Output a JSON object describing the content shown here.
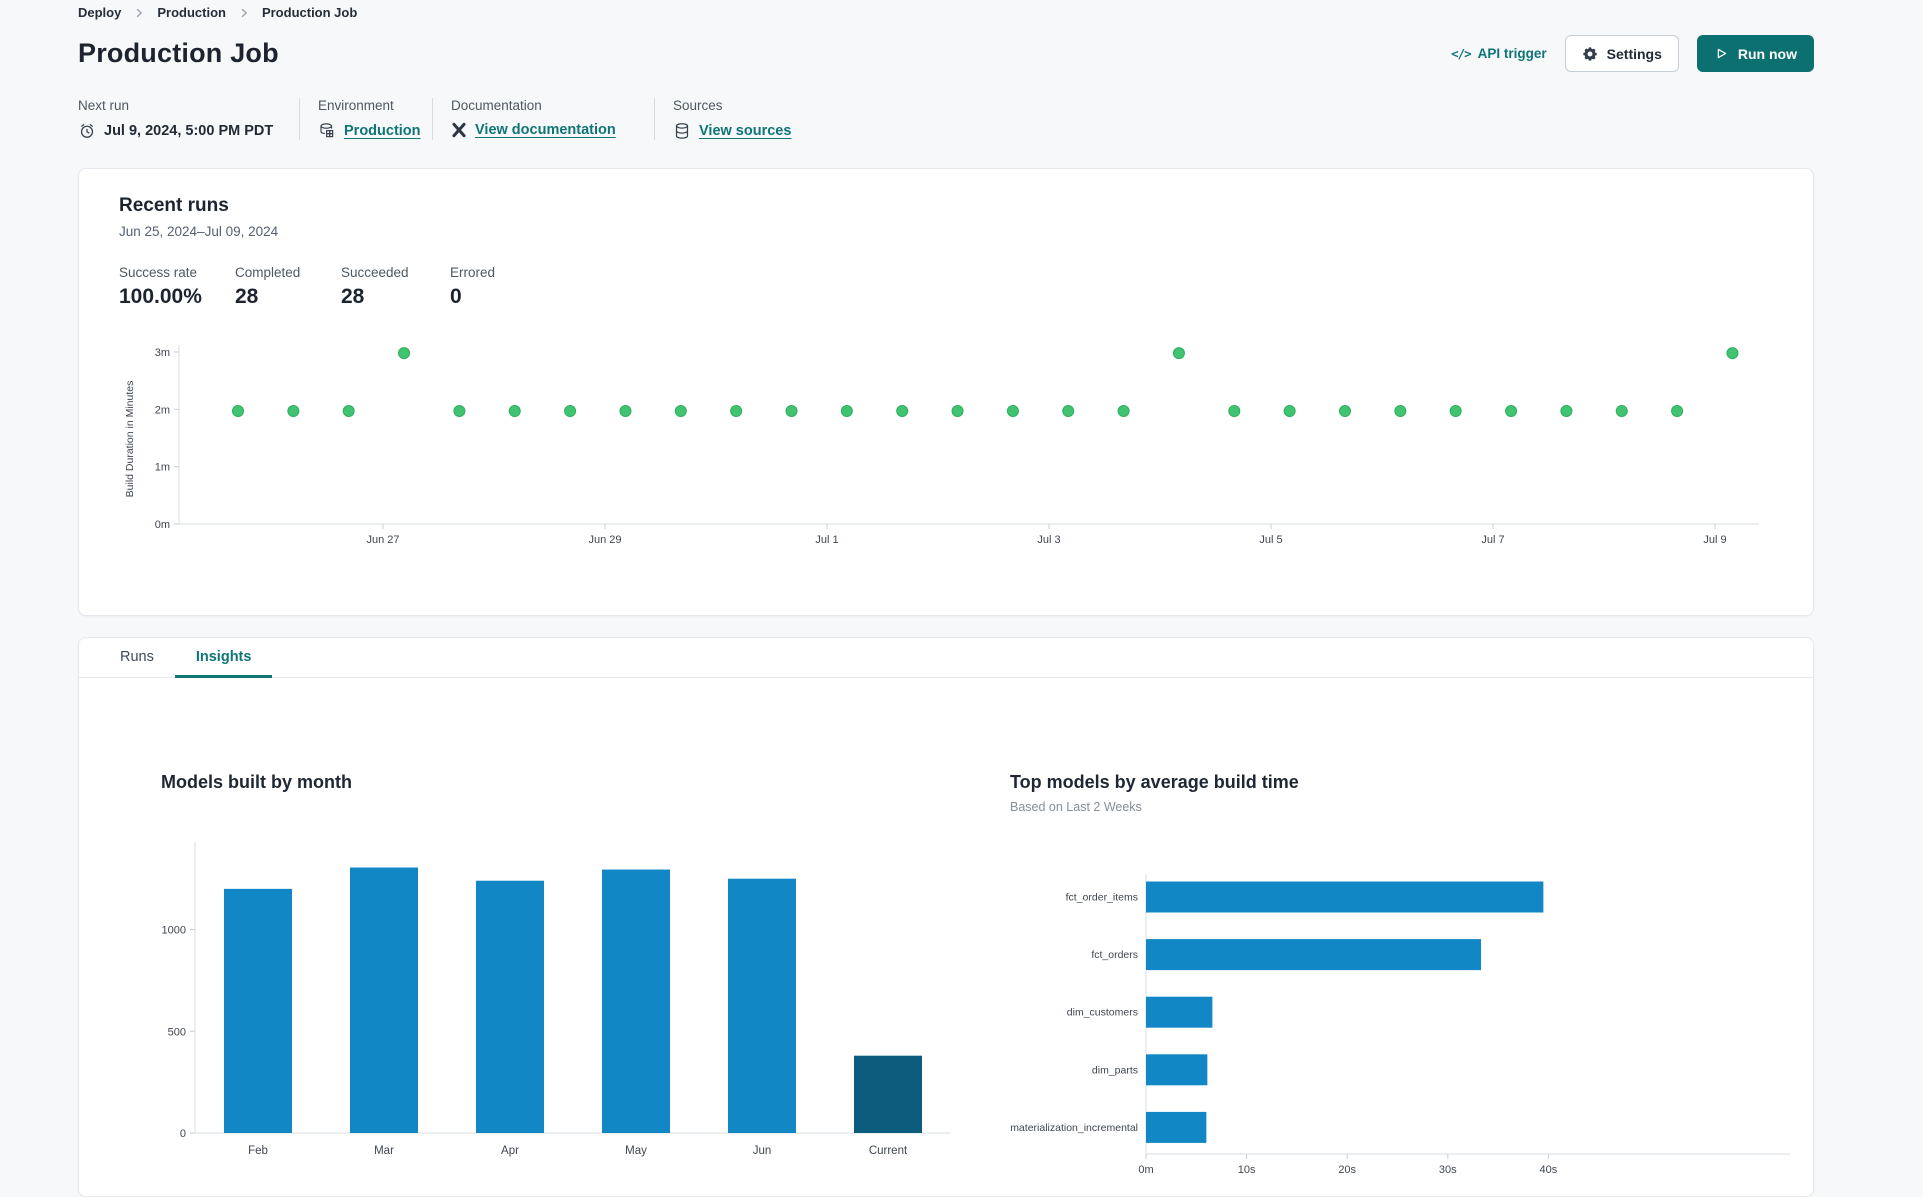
{
  "breadcrumb": {
    "items": [
      "Deploy",
      "Production",
      "Production Job"
    ]
  },
  "header": {
    "title": "Production Job",
    "api_trigger_label": "API trigger",
    "api_trigger_glyph": "</>",
    "settings_label": "Settings",
    "run_now_label": "Run now"
  },
  "meta": {
    "next_run": {
      "label": "Next run",
      "value": "Jul 9, 2024, 5:00 PM PDT"
    },
    "environment": {
      "label": "Environment",
      "value": "Production"
    },
    "documentation": {
      "label": "Documentation",
      "value": "View documentation"
    },
    "sources": {
      "label": "Sources",
      "value": "View sources"
    }
  },
  "recent_runs": {
    "title": "Recent runs",
    "date_range": "Jun 25, 2024–Jul 09, 2024",
    "stats": [
      {
        "label": "Success rate",
        "value": "100.00%"
      },
      {
        "label": "Completed",
        "value": "28"
      },
      {
        "label": "Succeeded",
        "value": "28"
      },
      {
        "label": "Errored",
        "value": "0"
      }
    ],
    "chart_data": {
      "type": "scatter",
      "ylabel": "Build Duration in Minutes",
      "y_ticks": [
        "0m",
        "1m",
        "2m",
        "3m"
      ],
      "ylim": [
        0,
        3.25
      ],
      "x_ticks": [
        "Jun 27",
        "Jun 29",
        "Jul 1",
        "Jul 3",
        "Jul 5",
        "Jul 7",
        "Jul 9"
      ],
      "point_color": "#41c472",
      "point_stroke": "#2fae5d",
      "points_minutes": [
        1.97,
        1.97,
        1.97,
        2.98,
        1.97,
        1.97,
        1.97,
        1.97,
        1.97,
        1.97,
        1.97,
        1.97,
        1.97,
        1.97,
        1.97,
        1.97,
        1.97,
        2.98,
        1.97,
        1.97,
        1.97,
        1.97,
        1.97,
        1.97,
        1.97,
        1.97,
        1.97,
        2.98
      ]
    }
  },
  "tabs": [
    {
      "label": "Runs",
      "active": false
    },
    {
      "label": "Insights",
      "active": true
    }
  ],
  "insights": {
    "models_by_month": {
      "title": "Models built by month",
      "chart_data": {
        "type": "bar",
        "categories": [
          "Feb",
          "Mar",
          "Apr",
          "May",
          "Jun",
          "Current"
        ],
        "values": [
          1200,
          1305,
          1240,
          1295,
          1250,
          380
        ],
        "y_ticks": [
          0,
          500,
          1000
        ],
        "ylim": [
          0,
          1450
        ],
        "bar_color": "#1287c5",
        "current_bar_color": "#0d5c7e"
      }
    },
    "top_models": {
      "title": "Top models by average build time",
      "subtitle": "Based on Last 2 Weeks",
      "chart_data": {
        "type": "bar-horizontal",
        "categories": [
          "fct_order_items",
          "fct_orders",
          "dim_customers",
          "dim_parts",
          "materialization_incremental"
        ],
        "values_seconds": [
          39.5,
          33.3,
          6.6,
          6.1,
          6.0
        ],
        "x_ticks": [
          "0m",
          "10s",
          "20s",
          "30s",
          "40s"
        ],
        "xlim": [
          0,
          44
        ],
        "bar_color": "#1287c5"
      }
    }
  },
  "colors": {
    "accent_teal": "#0f7576",
    "run_dot_green": "#41c472",
    "bar_blue": "#1287c5",
    "bar_navy": "#0d5c7e",
    "page_bg": "#f7f8fa"
  }
}
